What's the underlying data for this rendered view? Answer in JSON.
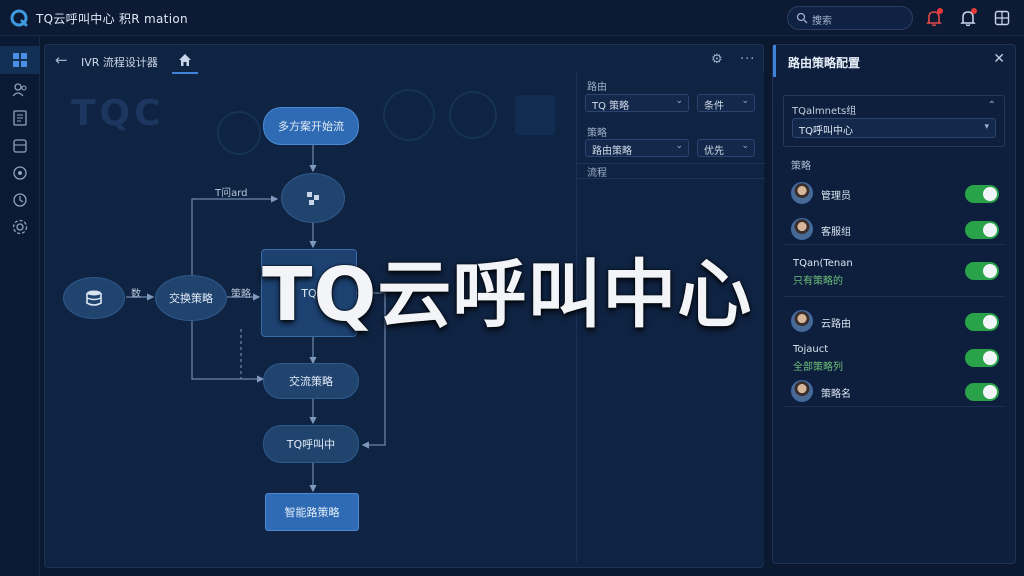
{
  "app": {
    "title": "TQ云呼叫中心 积R mation"
  },
  "top": {
    "search_text": "搜索"
  },
  "canvas": {
    "crumb": "IVR 流程设计器",
    "ghost_logo": "TQC",
    "nodes": {
      "start": "多方案开始流",
      "menu_label": "T问ard",
      "data_source_label": "数",
      "process": "交换策略",
      "process_out_label": "策略",
      "center": "TQ",
      "decision": "交流策略",
      "tq_call": "TQ呼叫中",
      "end": "智能路策略"
    }
  },
  "props": {
    "label_a": "路由",
    "sel_a1": "TQ 策略",
    "sel_a2": "条件",
    "label_b": "策略",
    "sel_b1": "路由策略",
    "sel_b2": "优先",
    "label_c": "流程"
  },
  "route": {
    "title": "路由策略配置",
    "group_label": "TQalmnets组",
    "group_select": "TQ呼叫中心",
    "section_label": "策略",
    "agents": [
      {
        "name": "管理员",
        "sub": "",
        "on": true
      },
      {
        "name": "客服组",
        "sub": "",
        "on": true
      },
      {
        "name": "TQan(Tenan",
        "sub": "只有策略的",
        "on": true
      },
      {
        "name": "云路由",
        "sub": "",
        "on": true
      },
      {
        "name": "Tojauct",
        "sub": "全部策略列",
        "on": true
      },
      {
        "name": "策略名",
        "sub": "",
        "on": true
      }
    ]
  },
  "overlay": {
    "title": "TQ云呼叫中心"
  }
}
